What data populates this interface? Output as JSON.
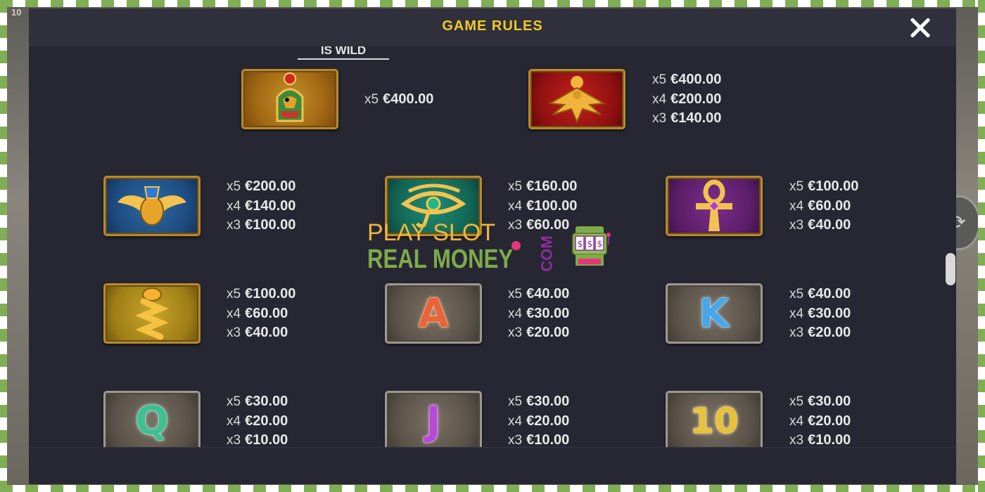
{
  "background": {
    "corner_label": "10"
  },
  "header": {
    "title": "GAME RULES"
  },
  "wild_text": "IS WILD",
  "top_rows": [
    {
      "icon": "horus-head-icon",
      "pays": [
        {
          "mult": "x5",
          "value": "€400.00"
        }
      ]
    },
    {
      "icon": "golden-falcon-icon",
      "pays": [
        {
          "mult": "x5",
          "value": "€400.00"
        },
        {
          "mult": "x4",
          "value": "€200.00"
        },
        {
          "mult": "x3",
          "value": "€140.00"
        }
      ]
    }
  ],
  "symbols": [
    {
      "icon": "scarab-icon",
      "pays": [
        {
          "mult": "x5",
          "value": "€200.00"
        },
        {
          "mult": "x4",
          "value": "€140.00"
        },
        {
          "mult": "x3",
          "value": "€100.00"
        }
      ]
    },
    {
      "icon": "eye-of-horus-icon",
      "pays": [
        {
          "mult": "x5",
          "value": "€160.00"
        },
        {
          "mult": "x4",
          "value": "€100.00"
        },
        {
          "mult": "x3",
          "value": "€60.00"
        }
      ]
    },
    {
      "icon": "ankh-icon",
      "pays": [
        {
          "mult": "x5",
          "value": "€100.00"
        },
        {
          "mult": "x4",
          "value": "€60.00"
        },
        {
          "mult": "x3",
          "value": "€40.00"
        }
      ]
    },
    {
      "icon": "djed-pillar-icon",
      "pays": [
        {
          "mult": "x5",
          "value": "€100.00"
        },
        {
          "mult": "x4",
          "value": "€60.00"
        },
        {
          "mult": "x3",
          "value": "€40.00"
        }
      ]
    },
    {
      "icon": "letter-a-icon",
      "letter": "A",
      "pays": [
        {
          "mult": "x5",
          "value": "€40.00"
        },
        {
          "mult": "x4",
          "value": "€30.00"
        },
        {
          "mult": "x3",
          "value": "€20.00"
        }
      ]
    },
    {
      "icon": "letter-k-icon",
      "letter": "K",
      "pays": [
        {
          "mult": "x5",
          "value": "€40.00"
        },
        {
          "mult": "x4",
          "value": "€30.00"
        },
        {
          "mult": "x3",
          "value": "€20.00"
        }
      ]
    },
    {
      "icon": "letter-q-icon",
      "letter": "Q",
      "pays": [
        {
          "mult": "x5",
          "value": "€30.00"
        },
        {
          "mult": "x4",
          "value": "€20.00"
        },
        {
          "mult": "x3",
          "value": "€10.00"
        }
      ]
    },
    {
      "icon": "letter-j-icon",
      "letter": "J",
      "pays": [
        {
          "mult": "x5",
          "value": "€30.00"
        },
        {
          "mult": "x4",
          "value": "€20.00"
        },
        {
          "mult": "x3",
          "value": "€10.00"
        }
      ]
    },
    {
      "icon": "number-10-icon",
      "letter": "10",
      "pays": [
        {
          "mult": "x5",
          "value": "€30.00"
        },
        {
          "mult": "x4",
          "value": "€20.00"
        },
        {
          "mult": "x3",
          "value": "€10.00"
        }
      ]
    }
  ],
  "watermark": {
    "line1": "PLAY SLOT",
    "line2": "REAL MONEY",
    "suffix": "COM"
  },
  "colors": {
    "title": "#f3c928",
    "panel": "#262733",
    "frame_green": "#7fae55"
  }
}
